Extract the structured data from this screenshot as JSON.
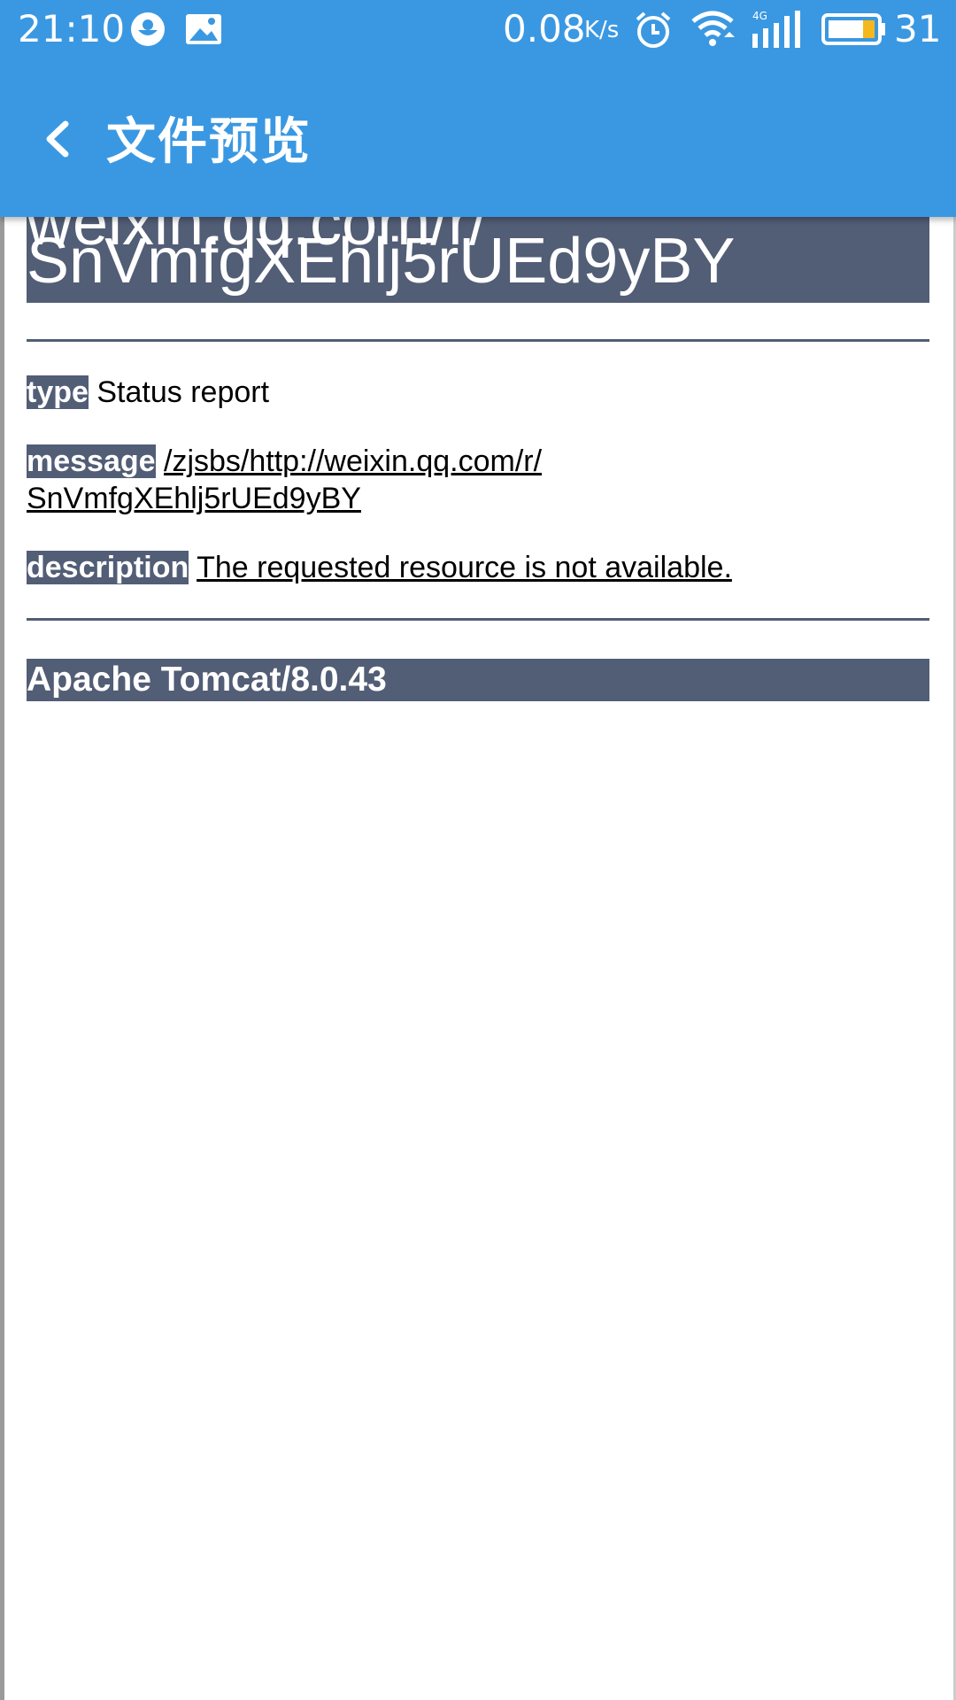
{
  "status_bar": {
    "time": "21:10",
    "net_speed": "0.08",
    "net_speed_unit": "K/s",
    "network_type": "4G",
    "battery_level": "31",
    "icons": [
      "face-icon",
      "gallery-icon",
      "alarm-icon",
      "wifi-icon",
      "signal-icon",
      "battery-icon"
    ]
  },
  "app_bar": {
    "title": "文件预览",
    "back_icon": "chevron-left-icon"
  },
  "page": {
    "heading_line1": "weixin.qq.com/r/",
    "heading_line2": "SnVmfgXEhlj5rUEd9yBY",
    "type_label": "type",
    "type_value": "Status report",
    "message_label": "message",
    "message_value_line1": "/zjsbs/http://weixin.qq.com/r/",
    "message_value_line2": "SnVmfgXEhlj5rUEd9yBY",
    "description_label": "description",
    "description_value": "The requested resource is not available.",
    "footer": "Apache Tomcat/8.0.43"
  },
  "colors": {
    "app_bar": "#3a98e2",
    "tomcat_band": "#525d76",
    "battery_fill": "#f5b81c"
  }
}
